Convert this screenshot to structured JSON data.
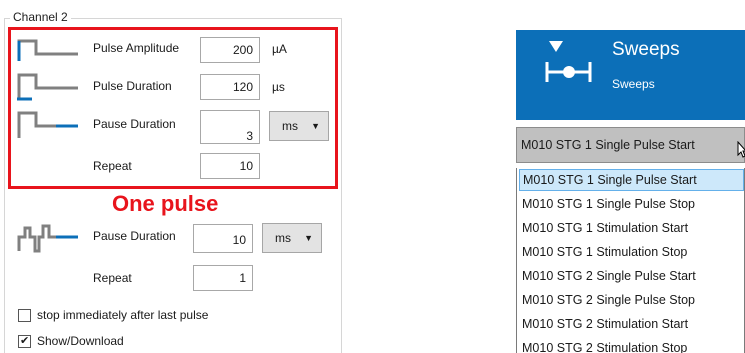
{
  "channel": {
    "title": "Channel 2"
  },
  "pulse": {
    "amplitude": {
      "label": "Pulse Amplitude",
      "value": "200",
      "unit": "µA"
    },
    "duration": {
      "label": "Pulse Duration",
      "value": "120",
      "unit": "µs"
    },
    "pause": {
      "label": "Pause Duration",
      "value": "3",
      "unit": "ms"
    },
    "repeat": {
      "label": "Repeat",
      "value": "10"
    }
  },
  "annotation": "One pulse",
  "train": {
    "pause": {
      "label": "Pause Duration",
      "value": "10",
      "unit": "ms"
    },
    "repeat": {
      "label": "Repeat",
      "value": "1"
    }
  },
  "options": {
    "stop_after_last": {
      "label": "stop immediately after last pulse",
      "checked": false
    },
    "show_download": {
      "label": "Show/Download",
      "checked": true
    }
  },
  "sweeps": {
    "title": "Sweeps",
    "subtitle": "Sweeps",
    "color": "#0c6fb8"
  },
  "dropdown": {
    "selected": "M010 STG 1 Single Pulse Start",
    "items": [
      "M010 STG 1 Single Pulse Start",
      "M010 STG 1 Single Pulse Stop",
      "M010 STG 1 Stimulation Start",
      "M010 STG 1 Stimulation Stop",
      "M010 STG 2 Single Pulse Start",
      "M010 STG 2 Single Pulse Stop",
      "M010 STG 2 Stimulation Start",
      "M010 STG 2 Stimulation Stop"
    ]
  },
  "colors": {
    "highlight": "#e8141c",
    "accent": "#0c6fb8"
  }
}
